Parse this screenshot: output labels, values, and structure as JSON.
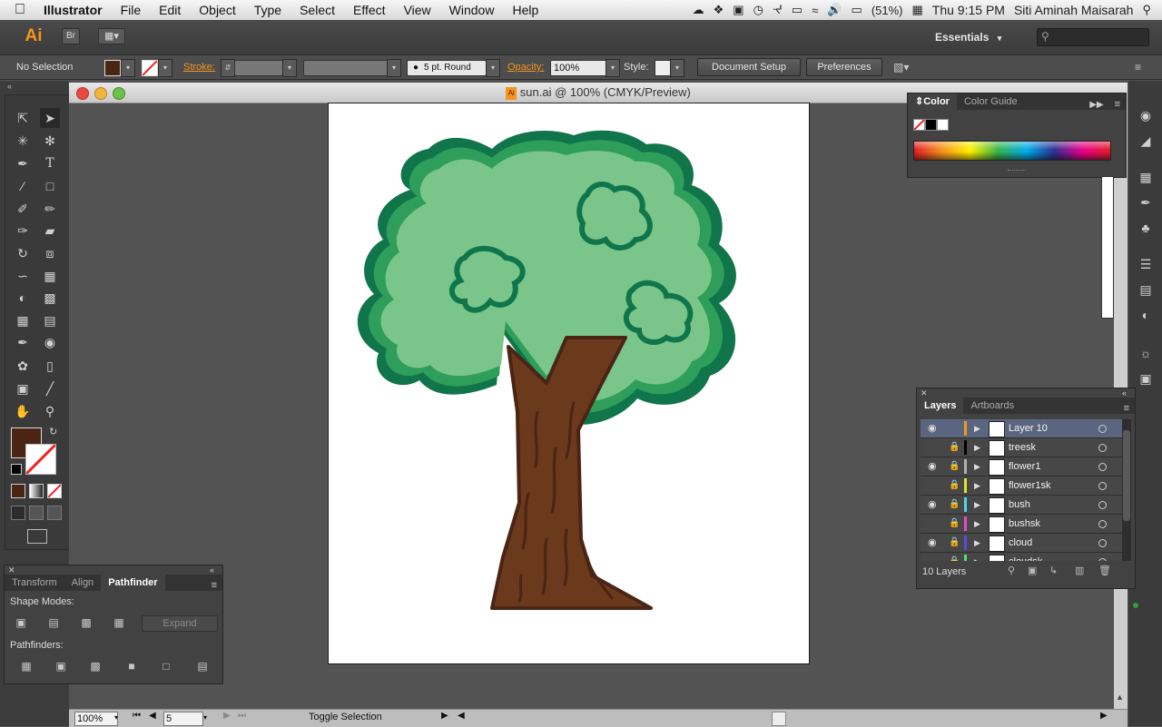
{
  "menubar": {
    "app_name": "Illustrator",
    "items": [
      "File",
      "Edit",
      "Object",
      "Type",
      "Select",
      "Effect",
      "View",
      "Window",
      "Help"
    ],
    "battery": "(51%)",
    "clock": "Thu 9:15 PM",
    "user": "Siti Aminah Maisarah"
  },
  "appbar": {
    "logo": "Ai",
    "bridge_label": "Br",
    "workspace": "Essentials"
  },
  "control": {
    "selection_label": "No Selection",
    "stroke_label": "Stroke:",
    "brush_label": "5 pt. Round",
    "opacity_label": "Opacity:",
    "opacity_value": "100%",
    "style_label": "Style:",
    "document_setup": "Document Setup",
    "preferences": "Preferences"
  },
  "document": {
    "title": "sun.ai @ 100% (CMYK/Preview)"
  },
  "colors": {
    "fill": "#4a2514",
    "tree_trunk": "#6b3a1c",
    "trunk_outline": "#4a2414",
    "foliage_light": "#7ac68a",
    "foliage_mid": "#2e9e5a",
    "foliage_dark": "#10754a"
  },
  "color_panel": {
    "tabs": [
      "Color",
      "Color Guide"
    ]
  },
  "layers_panel": {
    "tabs": [
      "Layers",
      "Artboards"
    ],
    "layers": [
      {
        "name": "Layer 10",
        "visible": true,
        "locked": false,
        "color": "#f7941d",
        "selected": true
      },
      {
        "name": "treesk",
        "visible": false,
        "locked": true,
        "color": "#000000",
        "selected": false
      },
      {
        "name": "flower1",
        "visible": true,
        "locked": true,
        "color": "#b0b0b0",
        "selected": false
      },
      {
        "name": "flower1sk",
        "visible": false,
        "locked": true,
        "color": "#e6e02a",
        "selected": false
      },
      {
        "name": "bush",
        "visible": true,
        "locked": true,
        "color": "#4ad9e8",
        "selected": false
      },
      {
        "name": "bushsk",
        "visible": false,
        "locked": true,
        "color": "#e24ad2",
        "selected": false
      },
      {
        "name": "cloud",
        "visible": true,
        "locked": true,
        "color": "#5a4ae2",
        "selected": false
      },
      {
        "name": "cloudsk",
        "visible": false,
        "locked": true,
        "color": "#4ae27a",
        "selected": false
      }
    ],
    "count_label": "10 Layers"
  },
  "pathfinder_panel": {
    "tabs": [
      "Transform",
      "Align",
      "Pathfinder"
    ],
    "shape_modes_label": "Shape Modes:",
    "expand_label": "Expand",
    "pathfinders_label": "Pathfinders:"
  },
  "statusbar": {
    "zoom": "100%",
    "artboard_num": "5",
    "status_text": "Toggle Selection"
  }
}
